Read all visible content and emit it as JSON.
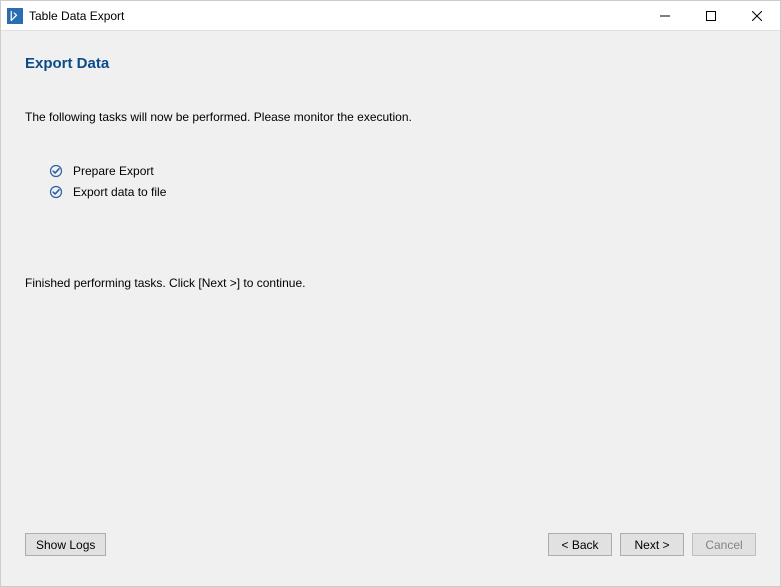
{
  "window": {
    "title": "Table Data Export"
  },
  "page": {
    "heading": "Export Data",
    "description": "The following tasks will now be performed. Please monitor the execution.",
    "status": "Finished performing tasks. Click [Next >] to continue."
  },
  "tasks": [
    {
      "label": "Prepare Export",
      "done": true
    },
    {
      "label": "Export data to file",
      "done": true
    }
  ],
  "buttons": {
    "show_logs": "Show Logs",
    "back": "< Back",
    "next": "Next >",
    "cancel": "Cancel"
  }
}
